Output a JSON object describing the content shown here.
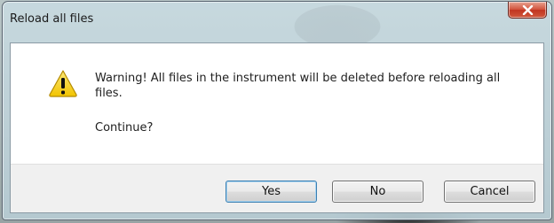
{
  "window": {
    "title": "Reload all files",
    "close_icon": "close-icon"
  },
  "message": {
    "icon": "warning-icon",
    "text": "Warning! All files in the instrument will be deleted before reloading all files.",
    "question": "Continue?"
  },
  "buttons": {
    "yes_label": "Yes",
    "no_label": "No",
    "cancel_label": "Cancel"
  },
  "colors": {
    "close_button": "#c9442d",
    "warning_fill": "#f7d117",
    "default_button_border": "#3c7fb1"
  }
}
